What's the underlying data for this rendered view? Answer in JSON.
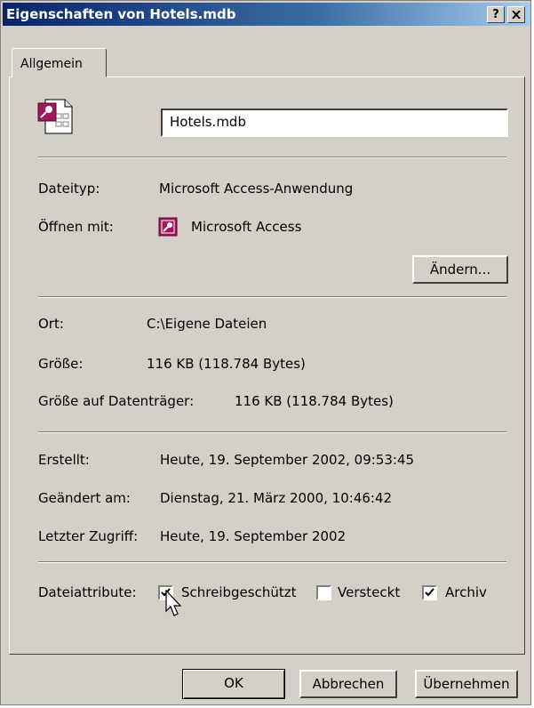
{
  "window": {
    "title": "Eigenschaften von Hotels.mdb",
    "help_button": "?",
    "close_button": "✕"
  },
  "tabs": [
    {
      "label": "Allgemein"
    }
  ],
  "file": {
    "name": "Hotels.mdb"
  },
  "details": {
    "type_label": "Dateityp:",
    "type_value": "Microsoft Access-Anwendung",
    "open_with_label": "Öffnen mit:",
    "open_with_value": "Microsoft Access",
    "change_button": "Ändern...",
    "location_label": "Ort:",
    "location_value": "C:\\Eigene Dateien",
    "size_label": "Größe:",
    "size_value": "116 KB (118.784 Bytes)",
    "disk_size_label": "Größe auf Datenträger:",
    "disk_size_value": "116 KB (118.784 Bytes)",
    "created_label": "Erstellt:",
    "created_value": "Heute, 19. September 2002, 09:53:45",
    "modified_label": "Geändert am:",
    "modified_value": "Dienstag, 21. März 2000, 10:46:42",
    "accessed_label": "Letzter Zugriff:",
    "accessed_value": "Heute, 19. September 2002"
  },
  "attributes": {
    "label": "Dateiattribute:",
    "readonly": {
      "label": "Schreibgeschützt",
      "checked": true
    },
    "hidden": {
      "label": "Versteckt",
      "checked": false
    },
    "archive": {
      "label": "Archiv",
      "checked": true
    }
  },
  "buttons": {
    "ok": "OK",
    "cancel": "Abbrechen",
    "apply": "Übernehmen"
  },
  "colors": {
    "title_start": "#0a246a",
    "title_end": "#a6caf0",
    "face": "#d4d0c8",
    "access_icon": "#a0185a"
  },
  "icons": {
    "file": "access-file-icon",
    "app": "access-app-icon",
    "cursor": "mouse-pointer-icon"
  }
}
